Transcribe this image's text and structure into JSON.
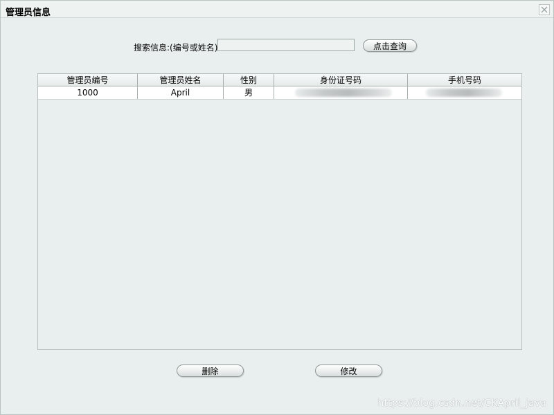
{
  "window": {
    "title": "管理员信息",
    "close_icon": "close-icon"
  },
  "search": {
    "label": "搜索信息:(编号或姓名)",
    "value": "",
    "placeholder": "",
    "button_label": "点击查询"
  },
  "table": {
    "columns": [
      "管理员编号",
      "管理员姓名",
      "性别",
      "身份证号码",
      "手机号码"
    ],
    "rows": [
      {
        "id": "1000",
        "name": "April",
        "gender": "男",
        "id_card": "",
        "phone": ""
      }
    ]
  },
  "actions": {
    "delete_label": "删除",
    "edit_label": "修改"
  },
  "watermark": "https://blog.csdn.net/CKApril_java",
  "colors": {
    "background": "#e9efee",
    "row_background": "#ffffff",
    "border": "#a6afae"
  }
}
